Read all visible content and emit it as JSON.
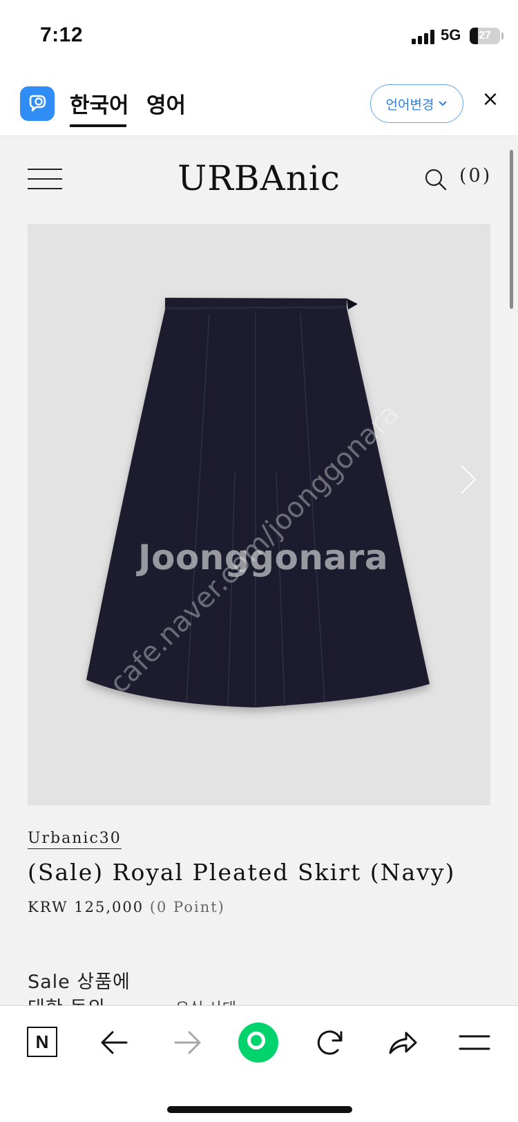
{
  "status_bar": {
    "time": "7:12",
    "network": "5G",
    "battery": "27",
    "battery_level": 0.27
  },
  "translator": {
    "active_language": "한국어",
    "other_language": "영어",
    "change_language_label": "언어변경",
    "change_language_chevron": "chevron-down-icon",
    "close_label": "×",
    "accent_color": "#2f8df5"
  },
  "site": {
    "brand": "URBAnic",
    "cart_count": "(0)",
    "icons": [
      "menu-icon",
      "search-icon",
      "chevron-right-icon"
    ]
  },
  "product": {
    "collection": "Urbanic30",
    "name": "(Sale) Royal Pleated Skirt (Navy)",
    "price": "KRW 125,000",
    "points": "(0 Point)",
    "skirt_color": "#1a1e2e"
  },
  "notice": {
    "title": "Sale 상품에",
    "line2": "대한 동의",
    "aside": "유실 사태"
  },
  "watermark": {
    "main": "Joonggonara",
    "diagonal": "cafe.naver.com/joonggonara"
  },
  "toolbar": {
    "n_label": "N",
    "icons": [
      "back-arrow-icon",
      "forward-arrow-icon",
      "green-dot-icon",
      "refresh-icon",
      "share-icon",
      "menu-icon"
    ]
  }
}
